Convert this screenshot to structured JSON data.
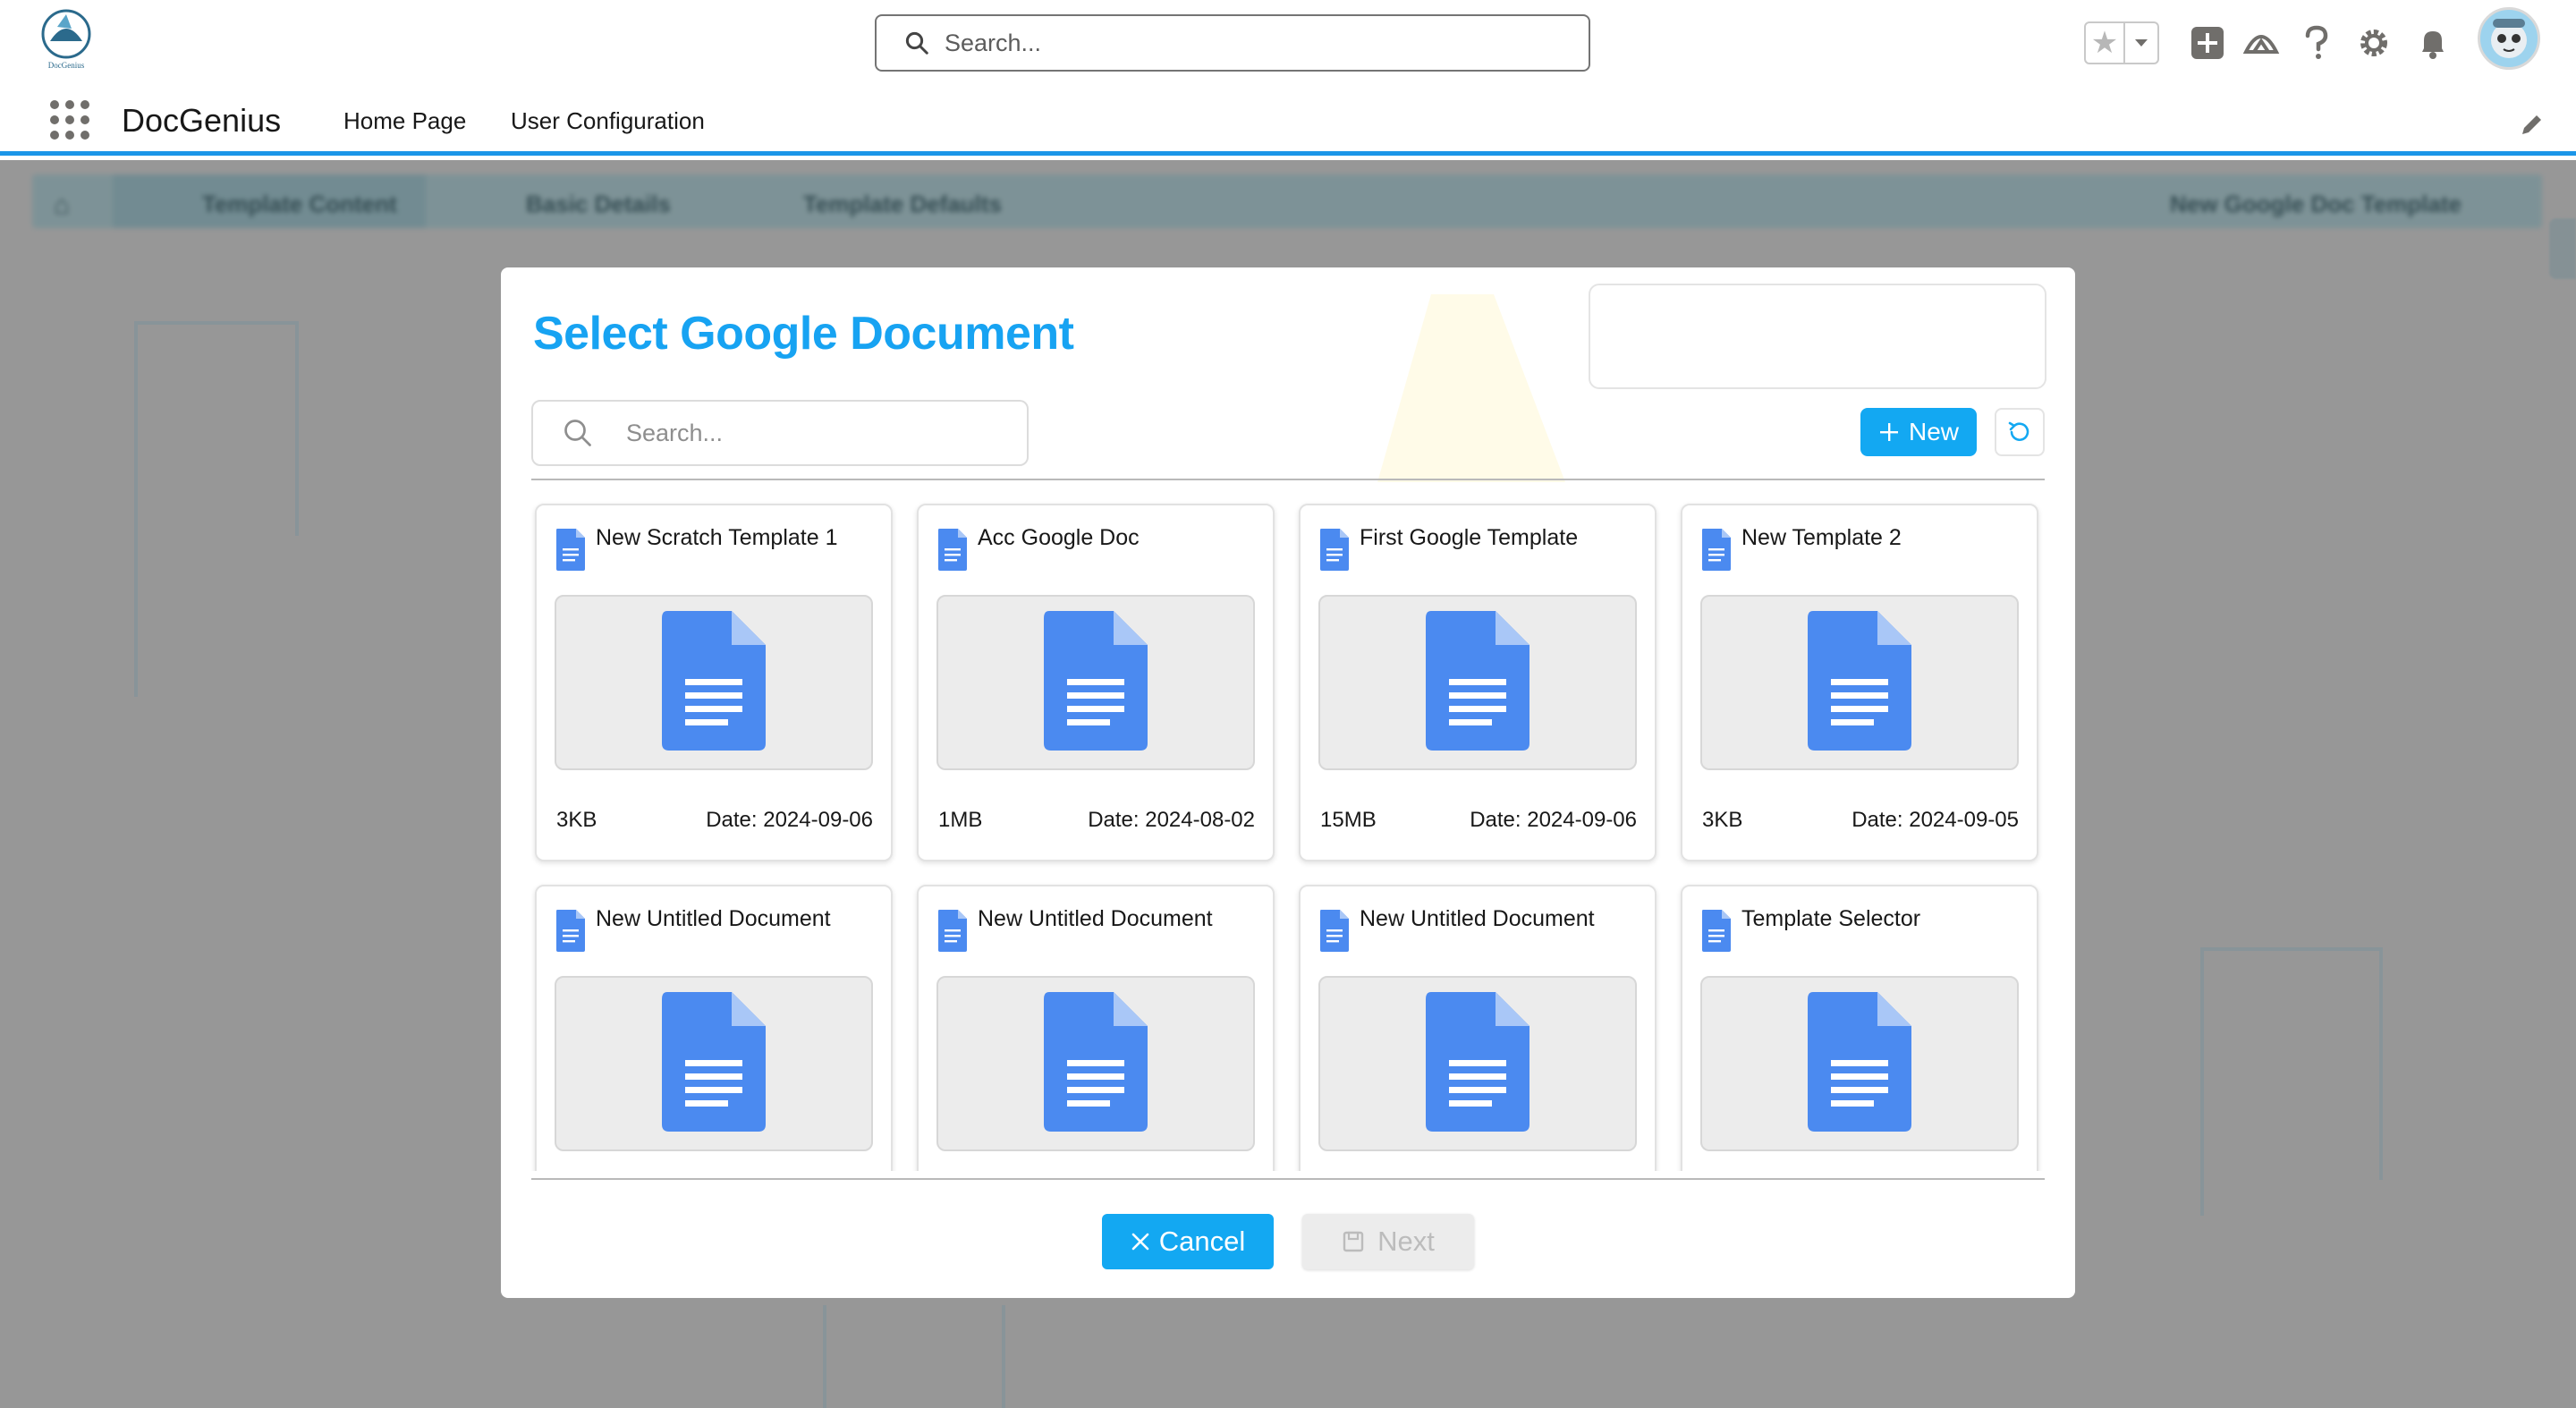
{
  "header": {
    "logo_text": "DocGenius",
    "search_placeholder": "Search...",
    "icons": [
      "star-icon",
      "chevron-down-icon",
      "add-icon",
      "trailhead-icon",
      "help-icon",
      "setup-gear-icon",
      "bell-icon",
      "user-avatar"
    ]
  },
  "app_bar": {
    "app_name": "DocGenius",
    "nav": [
      "Home Page",
      "User Configuration"
    ]
  },
  "background": {
    "tabs": [
      "Template Content",
      "Basic Details",
      "Template Defaults",
      "New Google Doc Template"
    ]
  },
  "modal": {
    "title": "Select Google Document",
    "search_placeholder": "Search...",
    "new_label": "New",
    "cancel_label": "Cancel",
    "next_label": "Next",
    "accent_color": "#13a8f2",
    "documents": [
      {
        "title": "New Scratch Template 1",
        "size": "3KB",
        "date": "Date: 2024-09-06"
      },
      {
        "title": "Acc Google Doc",
        "size": "1MB",
        "date": "Date: 2024-08-02"
      },
      {
        "title": "First Google Template",
        "size": "15MB",
        "date": "Date: 2024-09-06"
      },
      {
        "title": "New Template 2",
        "size": "3KB",
        "date": "Date: 2024-09-05"
      },
      {
        "title": "New Untitled Document",
        "size": "",
        "date": ""
      },
      {
        "title": "New Untitled Document",
        "size": "",
        "date": ""
      },
      {
        "title": "New Untitled Document",
        "size": "",
        "date": ""
      },
      {
        "title": "Template Selector",
        "size": "",
        "date": ""
      }
    ]
  }
}
